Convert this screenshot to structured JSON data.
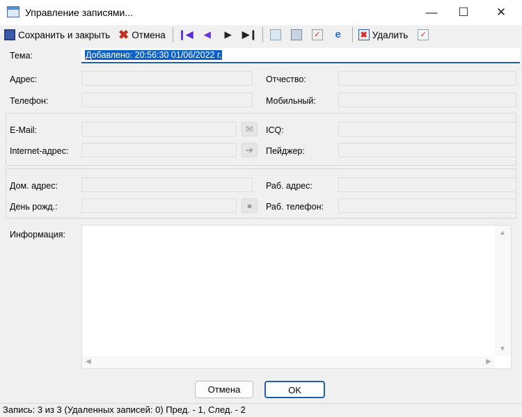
{
  "window": {
    "title": "Управление записями..."
  },
  "toolbar": {
    "save_close": "Сохранить и закрыть",
    "cancel": "Отмена",
    "delete": "Удалить"
  },
  "form": {
    "subject_label": "Тема:",
    "subject_value": "Добавлено: 20:56:30 01/06/2022 г.",
    "address_label": "Адрес:",
    "patronymic_label": "Отчество:",
    "phone_label": "Телефон:",
    "mobile_label": "Мобильный:",
    "email_label": "E-Mail:",
    "icq_label": "ICQ:",
    "internet_label": "Internet-адрес:",
    "pager_label": "Пейджер:",
    "home_address_label": "Дом. адрес:",
    "work_address_label": "Раб. адрес:",
    "birthday_label": "День рожд.:",
    "work_phone_label": "Раб. телефон:",
    "info_label": "Информация:"
  },
  "buttons": {
    "cancel": "Отмена",
    "ok": "OK"
  },
  "status": "Запись: 3 из 3 (Удаленных записей: 0) Пред. - 1, След. - 2"
}
